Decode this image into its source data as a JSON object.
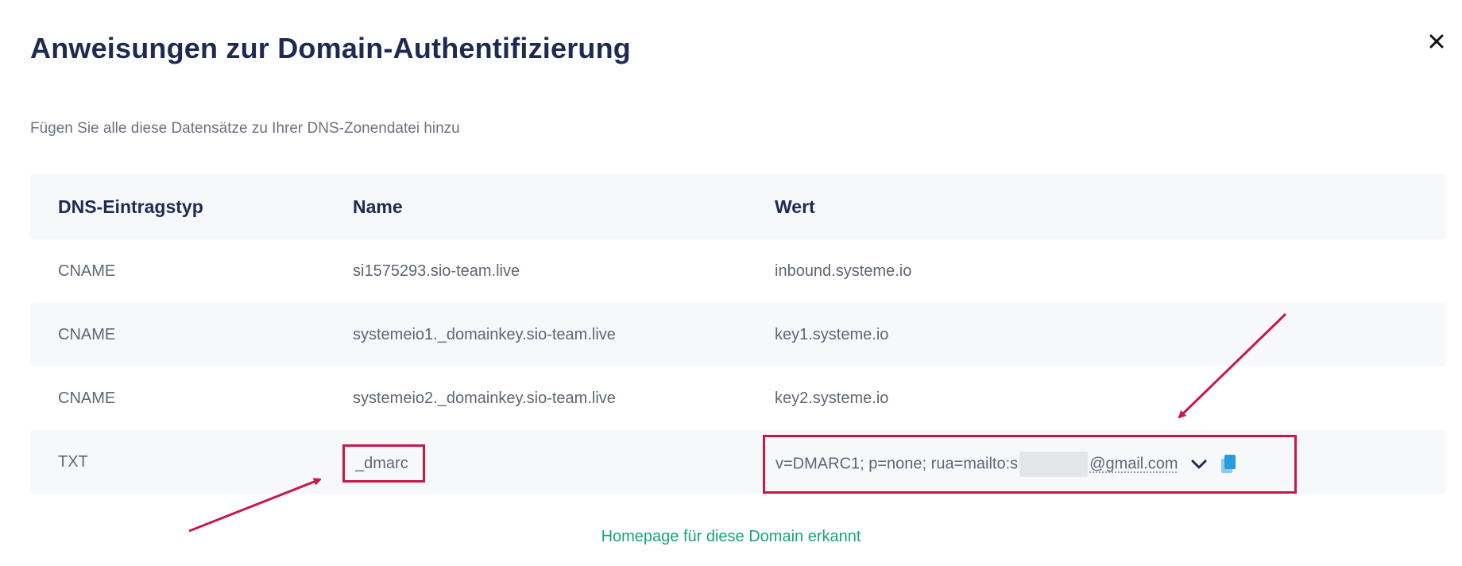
{
  "modal": {
    "title": "Anweisungen zur Domain-Authentifizierung",
    "subtitle": "Fügen Sie alle diese Datensätze zu Ihrer DNS-Zonendatei hinzu",
    "close_icon": "close-icon"
  },
  "table": {
    "headers": [
      "DNS-Eintragstyp",
      "Name",
      "Wert"
    ],
    "rows": [
      {
        "type": "CNAME",
        "name": "si1575293.sio-team.live",
        "value": "inbound.systeme.io"
      },
      {
        "type": "CNAME",
        "name": "systemeio1._domainkey.sio-team.live",
        "value": "key1.systeme.io"
      },
      {
        "type": "CNAME",
        "name": "systemeio2._domainkey.sio-team.live",
        "value": "key2.systeme.io"
      },
      {
        "type": "TXT",
        "name": "_dmarc",
        "value_prefix": "v=DMARC1; p=none; rua=mailto:",
        "value_partial": "s",
        "value_suffix": "@gmail.com"
      }
    ]
  },
  "footer": {
    "link": "Homepage für diese Domain erkannt"
  },
  "colors": {
    "title": "#1e2a52",
    "annotation": "#c8174b",
    "link": "#17a47a",
    "copy_icon": "#2b9be0"
  },
  "icons": {
    "expand": "chevron-down-icon",
    "copy": "copy-icon"
  }
}
